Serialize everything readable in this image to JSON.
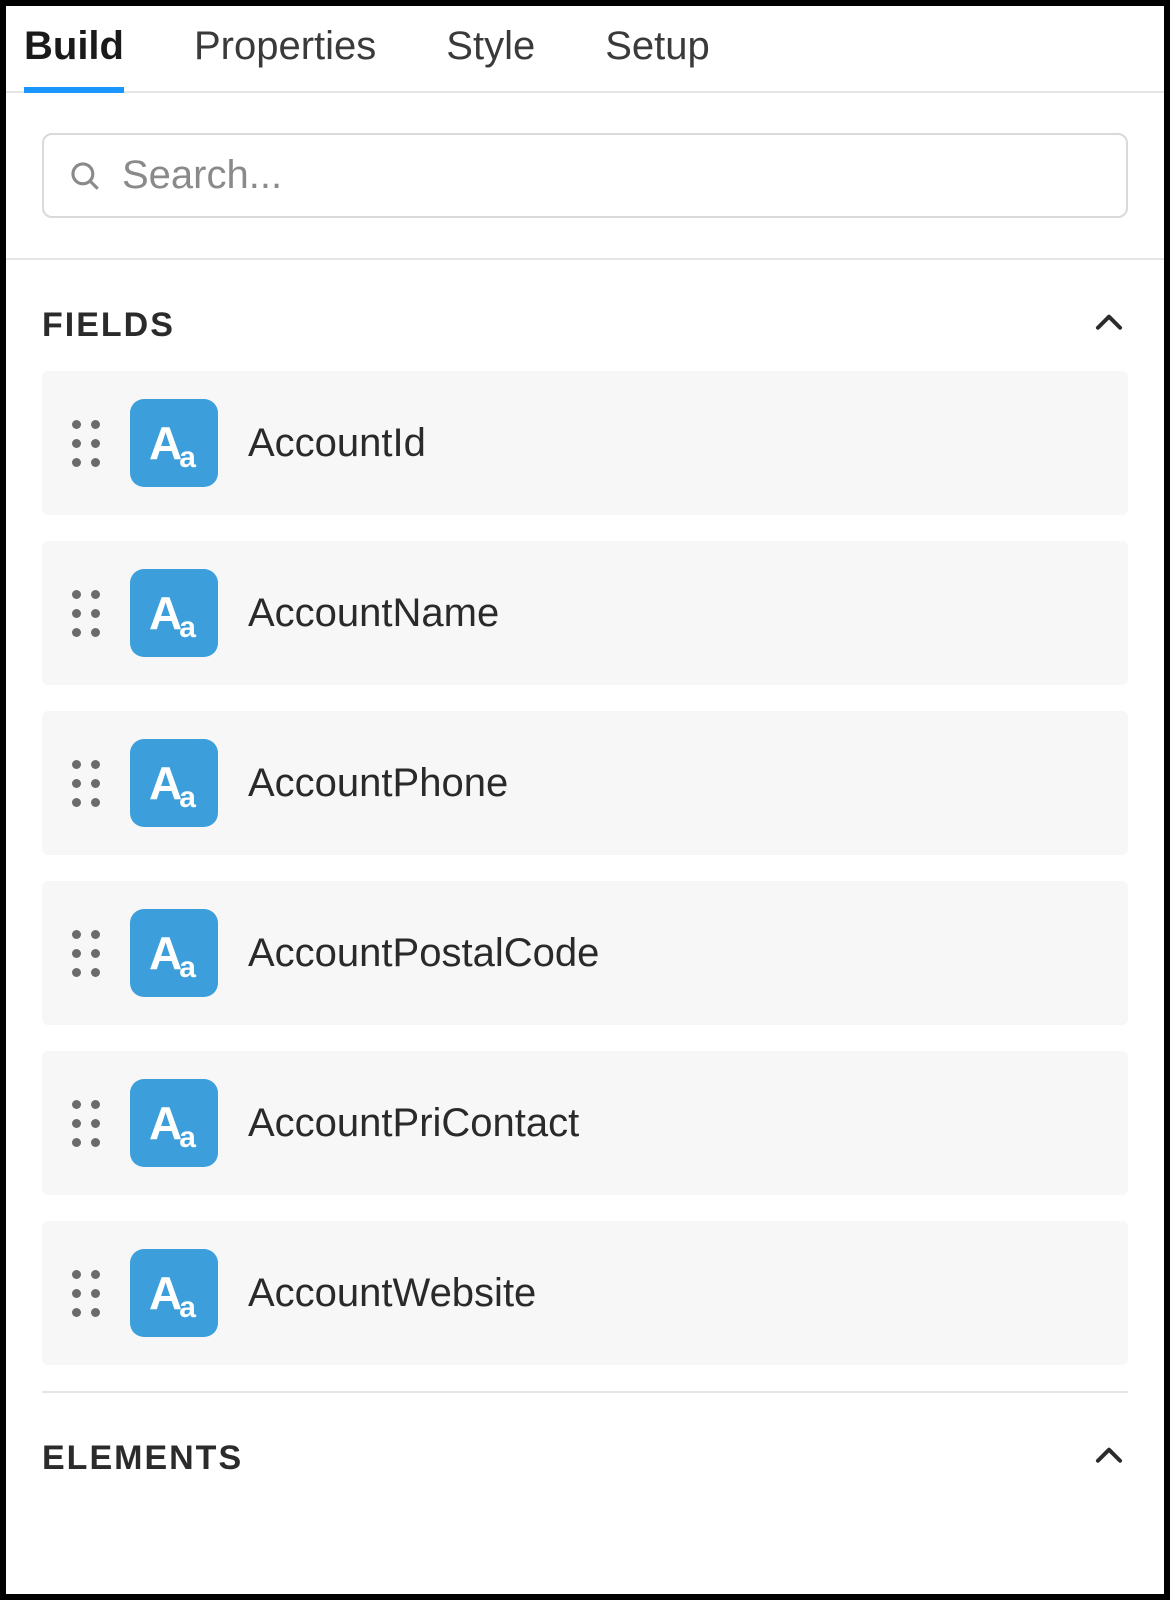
{
  "tabs": {
    "items": [
      {
        "label": "Build",
        "active": true
      },
      {
        "label": "Properties",
        "active": false
      },
      {
        "label": "Style",
        "active": false
      },
      {
        "label": "Setup",
        "active": false
      }
    ]
  },
  "search": {
    "placeholder": "Search..."
  },
  "sections": {
    "fields": {
      "title": "FIELDS",
      "items": [
        {
          "label": "AccountId",
          "type_icon": "text-type-icon"
        },
        {
          "label": "AccountName",
          "type_icon": "text-type-icon"
        },
        {
          "label": "AccountPhone",
          "type_icon": "text-type-icon"
        },
        {
          "label": "AccountPostalCode",
          "type_icon": "text-type-icon"
        },
        {
          "label": "AccountPriContact",
          "type_icon": "text-type-icon"
        },
        {
          "label": "AccountWebsite",
          "type_icon": "text-type-icon"
        }
      ]
    },
    "elements": {
      "title": "ELEMENTS"
    }
  }
}
